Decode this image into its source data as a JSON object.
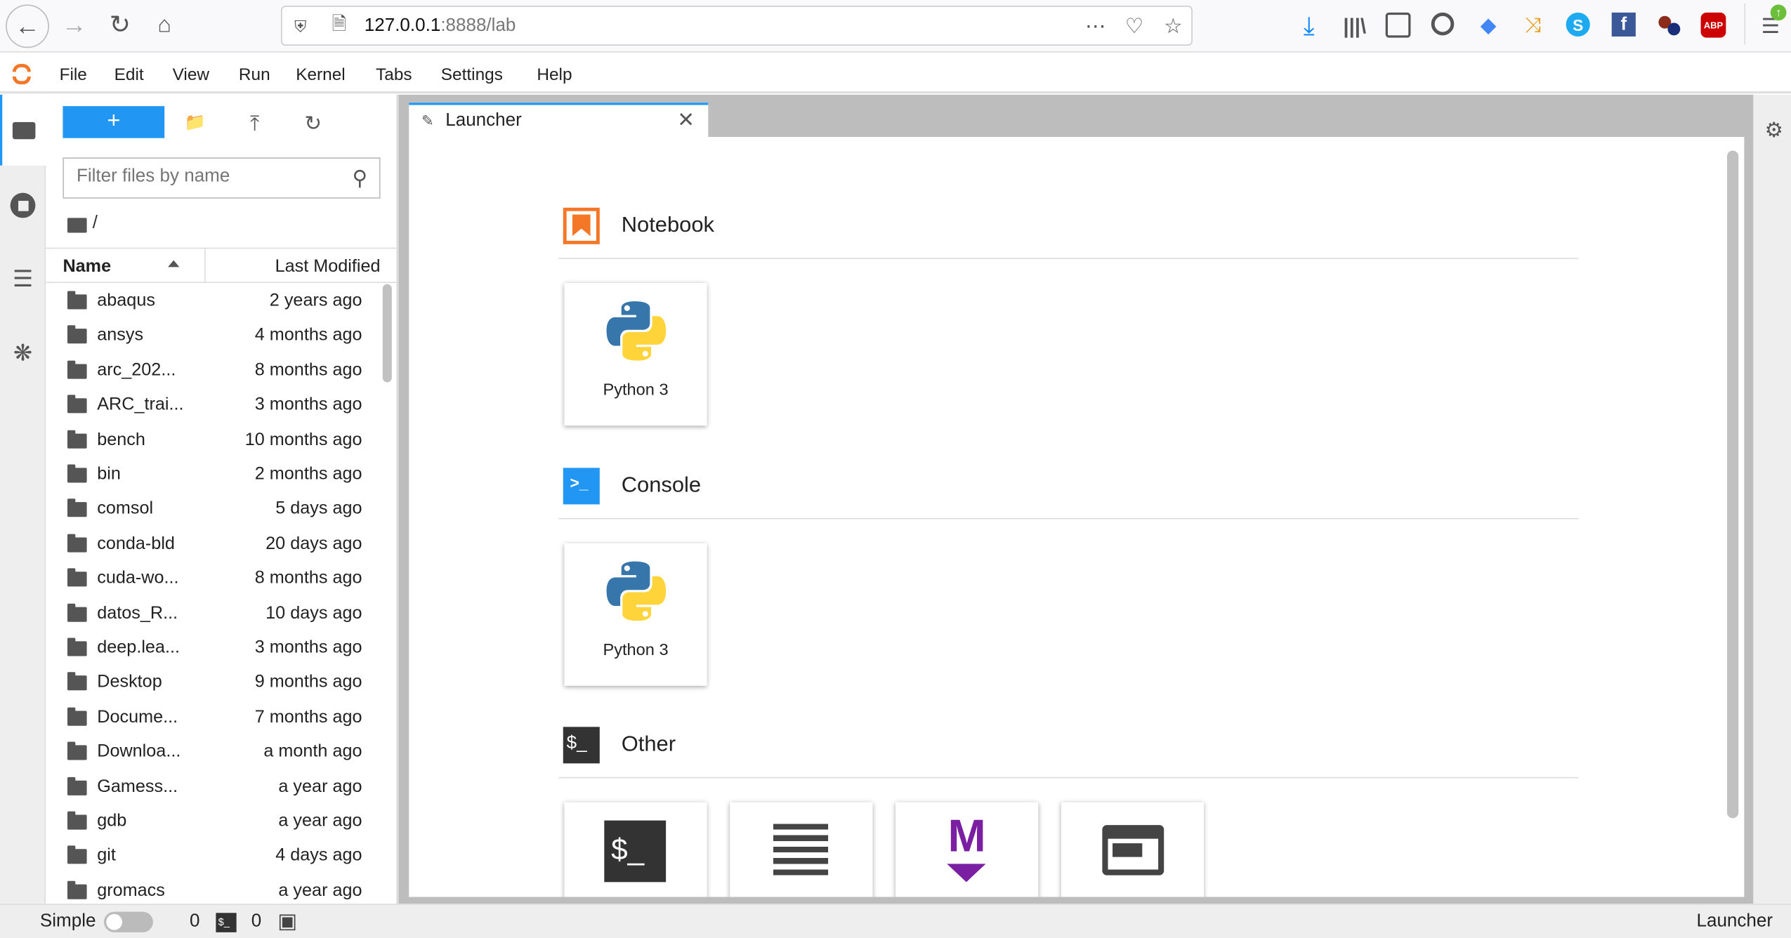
{
  "browser": {
    "url_host": "127.0.0.1",
    "url_rest": ":8888/lab",
    "icons": [
      "back-icon",
      "forward-icon",
      "reload-icon",
      "home-icon",
      "shield-icon",
      "page-icon",
      "more-icon",
      "pocket-icon",
      "bookmark-star-icon",
      "download-icon",
      "library-icon",
      "sidebar-icon",
      "account-icon",
      "extension-icon",
      "extension-icon",
      "skype-icon",
      "facebook-icon",
      "extension-icon",
      "adblock-icon",
      "menu-icon"
    ],
    "abp": "ABP"
  },
  "menu": [
    "File",
    "Edit",
    "View",
    "Run",
    "Kernel",
    "Tabs",
    "Settings",
    "Help"
  ],
  "filebrowser": {
    "new_label": "+",
    "filter_placeholder": "Filter files by name",
    "path": "/",
    "col_name": "Name",
    "col_modified": "Last Modified",
    "files": [
      {
        "name": "abaqus",
        "modified": "2 years ago"
      },
      {
        "name": "ansys",
        "modified": "4 months ago"
      },
      {
        "name": "arc_202...",
        "modified": "8 months ago"
      },
      {
        "name": "ARC_trai...",
        "modified": "3 months ago"
      },
      {
        "name": "bench",
        "modified": "10 months ago"
      },
      {
        "name": "bin",
        "modified": "2 months ago"
      },
      {
        "name": "comsol",
        "modified": "5 days ago"
      },
      {
        "name": "conda-bld",
        "modified": "20 days ago"
      },
      {
        "name": "cuda-wo...",
        "modified": "8 months ago"
      },
      {
        "name": "datos_R...",
        "modified": "10 days ago"
      },
      {
        "name": "deep.lea...",
        "modified": "3 months ago"
      },
      {
        "name": "Desktop",
        "modified": "9 months ago"
      },
      {
        "name": "Docume...",
        "modified": "7 months ago"
      },
      {
        "name": "Downloa...",
        "modified": "a month ago"
      },
      {
        "name": "Gamess...",
        "modified": "a year ago"
      },
      {
        "name": "gdb",
        "modified": "a year ago"
      },
      {
        "name": "git",
        "modified": "4 days ago"
      },
      {
        "name": "gromacs",
        "modified": "a year ago"
      }
    ]
  },
  "tab": {
    "label": "Launcher"
  },
  "launcher": {
    "notebook": {
      "title": "Notebook",
      "kernel": "Python 3"
    },
    "console": {
      "title": "Console",
      "kernel": "Python 3"
    },
    "other": {
      "title": "Other",
      "console_glyph": "$_",
      "markdown_glyph": "M"
    }
  },
  "status": {
    "mode": "Simple",
    "terminals": "0",
    "kernels": "0",
    "right": "Launcher"
  },
  "colors": {
    "accent": "#2196f3",
    "jupyter_orange": "#f37726",
    "markdown_purple": "#7b1fa2"
  }
}
